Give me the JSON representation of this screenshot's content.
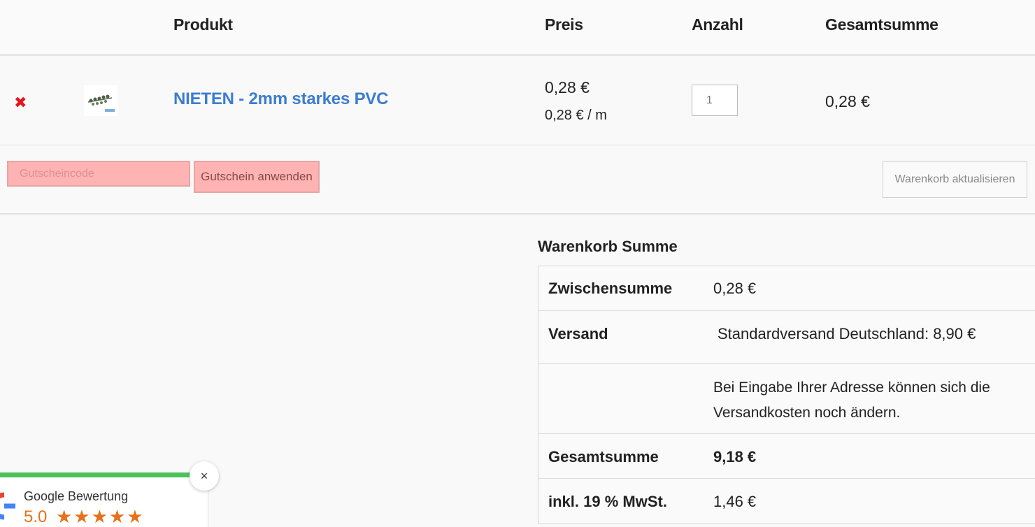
{
  "header": {
    "product": "Produkt",
    "price": "Preis",
    "quantity": "Anzahl",
    "total": "Gesamtsumme"
  },
  "cart_item": {
    "remove_icon": "close-icon",
    "name": "NIETEN - 2mm starkes PVC",
    "price": "0,28 €",
    "unit_price": "0,28 € / m",
    "quantity": "1",
    "total": "0,28 €"
  },
  "coupon": {
    "placeholder": "Gutscheincode",
    "apply_label": "Gutschein anwenden",
    "update_label": "Warenkorb aktualisieren",
    "highlight_color": "#ffb3b3"
  },
  "totals": {
    "title": "Warenkorb Summe",
    "subtotal_label": "Zwischensumme",
    "subtotal_value": "0,28 €",
    "shipping_label": "Versand",
    "shipping_value": "Standardversand Deutschland: 8,90 €",
    "shipping_note": "Bei Eingabe Ihrer Adresse können sich die Versandkosten noch ändern.",
    "total_label": "Gesamtsumme",
    "total_value": "9,18 €",
    "tax_label": "inkl. 19 % MwSt.",
    "tax_value": "1,46 €"
  },
  "review_widget": {
    "title": "Google Bewertung",
    "score": "5.0",
    "stars": "★★★★★",
    "rating": 5,
    "close_icon": "×",
    "accent_color": "#4cc35a",
    "star_color": "#e7711b"
  },
  "colors": {
    "link": "#3b7dd0",
    "remove": "#e3161b"
  }
}
